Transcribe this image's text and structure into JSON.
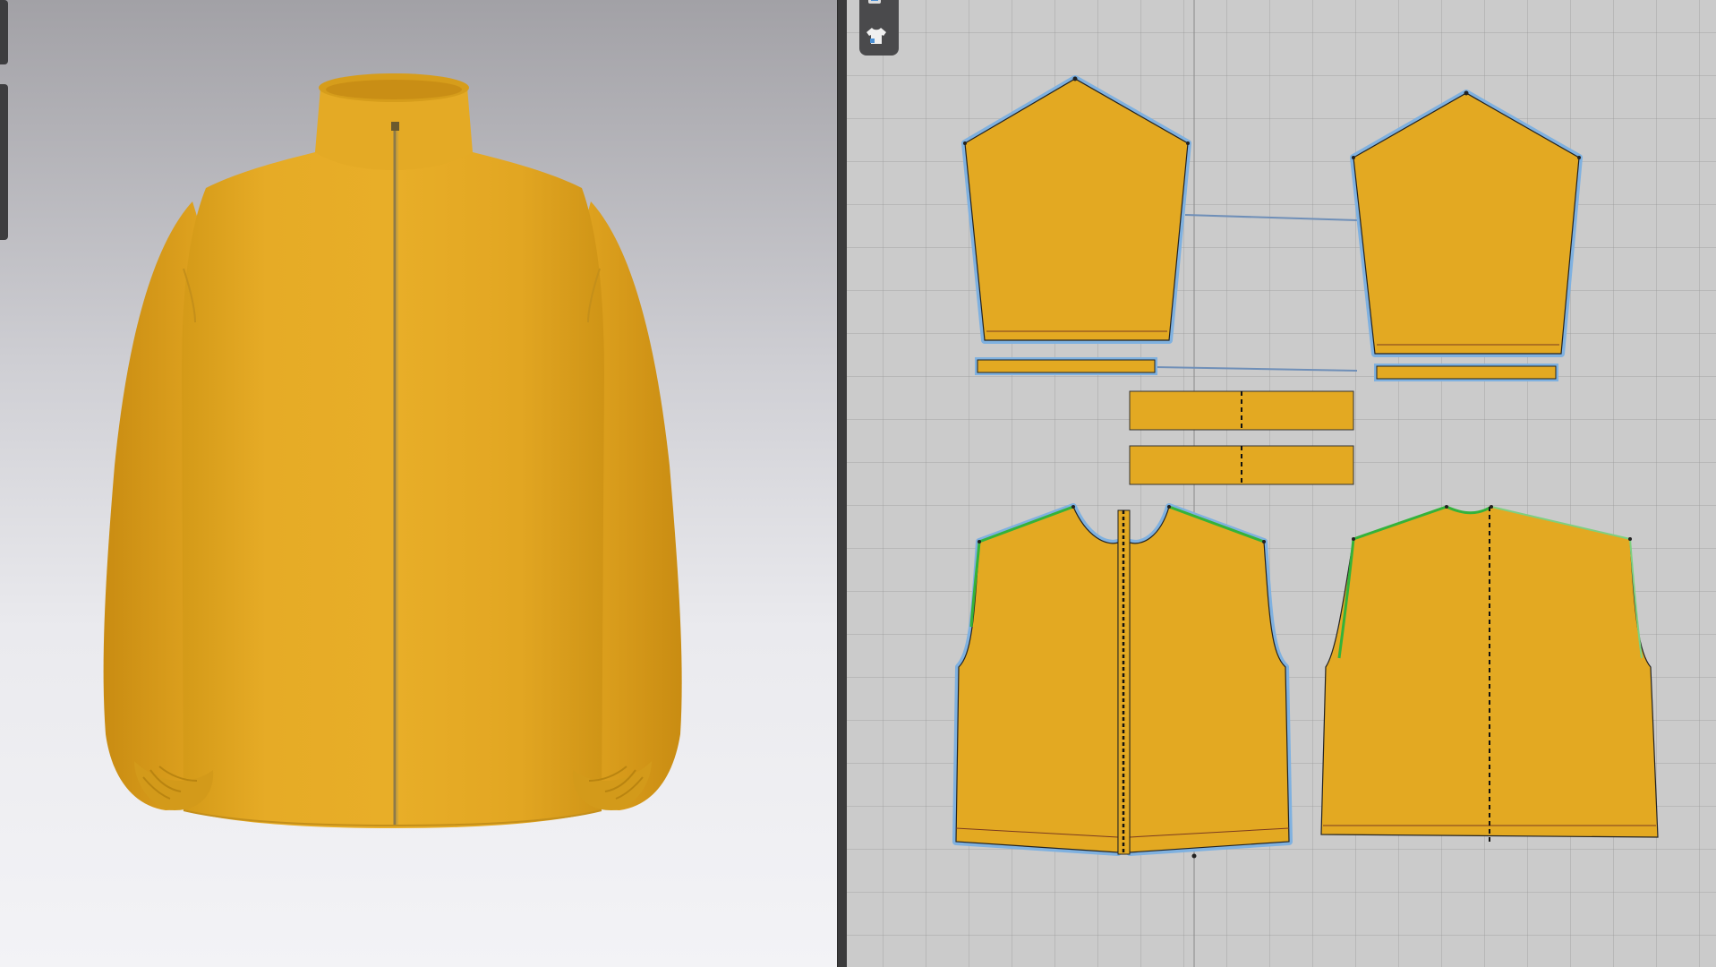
{
  "app": {
    "left_panel": "3d-garment-view",
    "right_panel": "2d-pattern-view"
  },
  "toolbar_2d": {
    "buttons": [
      {
        "icon": "layer-icon"
      },
      {
        "icon": "garment-shirt-icon"
      }
    ]
  },
  "garment": {
    "color": "#E3A924",
    "seam_color": "#7fb1e0",
    "sewing_color": "#34b33a"
  },
  "pattern_pieces": [
    {
      "name": "sleeve-left"
    },
    {
      "name": "sleeve-right"
    },
    {
      "name": "cuff-left"
    },
    {
      "name": "cuff-right"
    },
    {
      "name": "collar-upper"
    },
    {
      "name": "collar-lower"
    },
    {
      "name": "front-body"
    },
    {
      "name": "back-body"
    }
  ]
}
